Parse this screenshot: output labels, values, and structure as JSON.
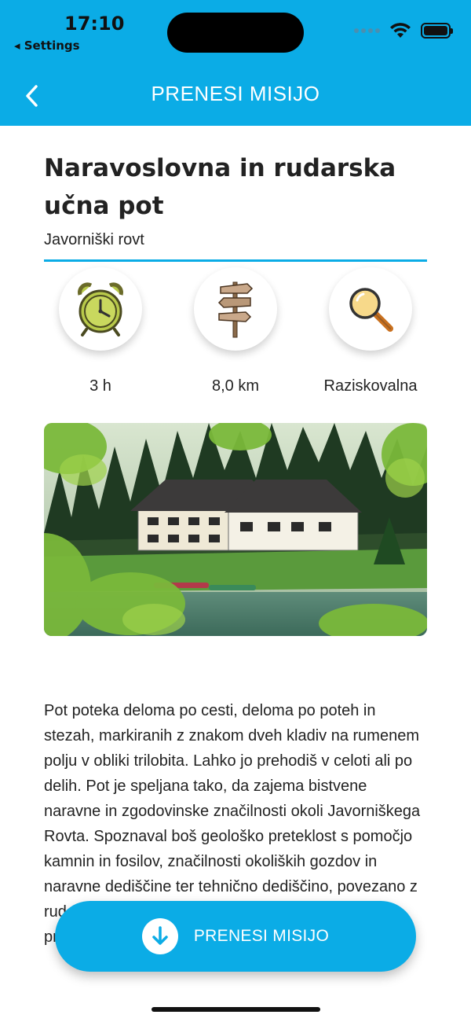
{
  "status_bar": {
    "time": "17:10",
    "back_app": "◂ Settings"
  },
  "header": {
    "title": "PRENESI MISIJO"
  },
  "mission": {
    "title": "Naravoslovna in rudarska učna pot",
    "location": "Javorniški rovt",
    "stats": [
      {
        "icon": "alarm-clock-icon",
        "label": "3 h"
      },
      {
        "icon": "signpost-icon",
        "label": "8,0 km"
      },
      {
        "icon": "magnifier-icon",
        "label": "Raziskovalna"
      }
    ],
    "description": "Pot poteka deloma po cesti, deloma po poteh in stezah, markiranih z znakom dveh kladiv na rumenem polju v obliki trilobita. Lahko jo prehodiš v celoti ali po delih. Pot je speljana tako, da zajema bistvene naravne in zgodovinske značilnosti okoli Javorniškega Rovta. Spoznaval boš geološko preteklost s pomočjo kamnin in fosilov, značilnosti okoliških gozdov in naravne dediščine ter tehnično dediščino, povezano z rudarstvom in tehnologijo, ki se je uporabljala za pridobivanje železa."
  },
  "download_button": {
    "label": "PRENESI MISIJO"
  },
  "colors": {
    "accent": "#0bace6",
    "text": "#222222"
  }
}
